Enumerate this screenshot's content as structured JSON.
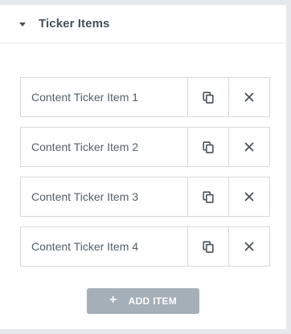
{
  "section": {
    "title": "Ticker Items",
    "expanded": true,
    "caret_icon": "caret-down-icon"
  },
  "items": [
    {
      "label": "Content Ticker Item 1"
    },
    {
      "label": "Content Ticker Item 2"
    },
    {
      "label": "Content Ticker Item 3"
    },
    {
      "label": "Content Ticker Item 4"
    }
  ],
  "item_tools": {
    "duplicate_icon": "copy-icon",
    "remove_icon": "close-icon"
  },
  "add_button": {
    "icon": "+",
    "label": "ADD ITEM"
  },
  "colors": {
    "text": "#495157",
    "border": "#d5dadf",
    "button_bg": "#a4afb7",
    "page_bg": "#e6e9ec"
  }
}
